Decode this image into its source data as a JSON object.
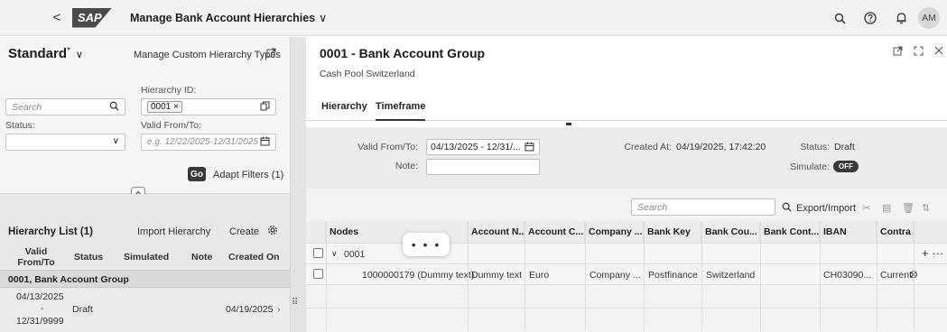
{
  "shell": {
    "back_glyph": "<",
    "logo_text": "SAP",
    "app_title": "Manage Bank Account Hierarchies",
    "title_chevron": "∨",
    "avatar_initials": "AM"
  },
  "filter_bar": {
    "variant_name": "Standard",
    "variant_modified": "*",
    "variant_chevron": "∨",
    "manage_link": "Manage Custom Hierarchy Types",
    "search_placeholder": "Search",
    "hierarchy_id_label": "Hierarchy ID:",
    "hierarchy_id_token": "0001",
    "status_label": "Status:",
    "valid_from_to_label": "Valid From/To:",
    "valid_from_to_placeholder": "e.g. 12/22/2025-12/31/2025",
    "go_label": "Go",
    "adapt_filters_label": "Adapt Filters (1)"
  },
  "hierarchy_list": {
    "title": "Hierarchy List (1)",
    "import_label": "Import Hierarchy",
    "create_label": "Create",
    "columns": [
      "Valid From/To",
      "Status",
      "Simulated",
      "Note",
      "Created On"
    ],
    "group_label": "0001, Bank Account Group",
    "rows": [
      {
        "valid_from": "04/13/2025",
        "dash": "-",
        "valid_to": "12/31/9999",
        "status": "Draft",
        "created_on": "04/19/2025"
      }
    ]
  },
  "object_page": {
    "title": "0001 - Bank Account Group",
    "subtitle": "Cash Pool Switzerland",
    "tabs": [
      "Hierarchy",
      "Timeframe"
    ],
    "active_tab": "Timeframe",
    "valid_from_to_label": "Valid From/To:",
    "valid_from_to_value": "04/13/2025 - 12/31/...",
    "note_label": "Note:",
    "created_at_label": "Created At:",
    "created_at_value": "04/19/2025, 17:42:20",
    "status_label": "Status:",
    "status_value": "Draft",
    "simulate_label": "Simulate:",
    "simulate_value": "OFF"
  },
  "table": {
    "search_placeholder": "Search",
    "export_import_label": "Export/Import",
    "columns": [
      "Nodes",
      "Account N...",
      "Account C...",
      "Company ...",
      "Bank Key",
      "Bank Cou...",
      "Bank Cont...",
      "IBAN",
      "Contra"
    ],
    "rows": [
      {
        "node": "0001",
        "account_name": "",
        "currency": "",
        "company": "",
        "bank_key": "",
        "bank_country": "",
        "bank_contact": "",
        "iban": "",
        "contract": "",
        "row_action": "+ ···"
      },
      {
        "node": "1000000179 (Dummy text)",
        "account_name": "Dummy text",
        "currency": "Euro",
        "company": "Company ...",
        "bank_key": "Postfinance",
        "bank_country": "Switzerland",
        "bank_contact": "",
        "iban": "CH03090...",
        "contract": "Current",
        "row_action": "⊗"
      }
    ],
    "busy_indicator": "• • •"
  },
  "icons": {
    "search": "search-icon",
    "help": "help-icon",
    "bell": "notification-icon",
    "copy": "copy-icon",
    "calendar": "calendar-icon",
    "dropdown": "chevron-down-icon"
  }
}
